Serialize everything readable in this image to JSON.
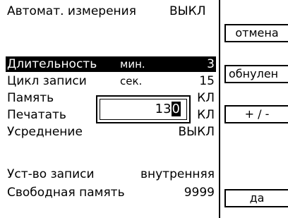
{
  "header": {
    "title": "Автомат. измерения",
    "status": "ВЫКЛ"
  },
  "rows": [
    {
      "label": "Длительность",
      "unit": "мин.",
      "value": "3",
      "selected": true
    },
    {
      "label": "Цикл записи",
      "unit": "сек.",
      "value": "15",
      "selected": false
    },
    {
      "label": "Память",
      "unit": "",
      "value": "КЛ",
      "selected": false
    },
    {
      "label": "Печатать",
      "unit": "",
      "value": "КЛ",
      "selected": false
    },
    {
      "label": "Усреднение",
      "unit": "",
      "value": "ВЫКЛ",
      "selected": false
    },
    {
      "label": "Уст-во записи",
      "unit": "",
      "value": "внутренняя",
      "selected": false
    },
    {
      "label": "Свободная память",
      "unit": "",
      "value": "9999",
      "selected": false
    }
  ],
  "editor": {
    "value_prefix": "13",
    "value_cursor": "0"
  },
  "softkeys": {
    "cancel": "отмена",
    "reset": "обнулен",
    "sign": "+ / -",
    "ok": "да"
  }
}
